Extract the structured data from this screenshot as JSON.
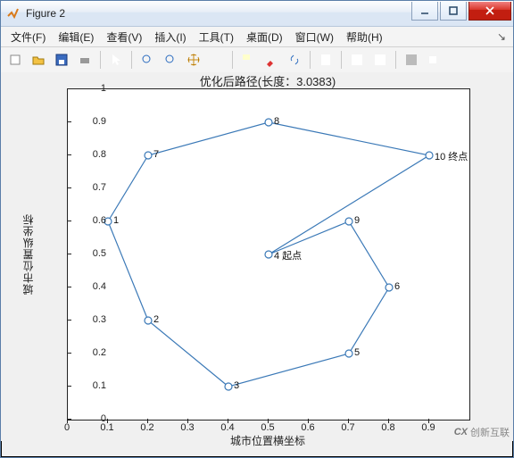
{
  "window": {
    "title": "Figure 2"
  },
  "winbtns": {
    "min": "min",
    "max": "max",
    "close": "close"
  },
  "menu": {
    "file": "文件(F)",
    "edit": "编辑(E)",
    "view": "查看(V)",
    "insert": "插入(I)",
    "tools": "工具(T)",
    "desktop": "桌面(D)",
    "window": "窗口(W)",
    "help": "帮助(H)"
  },
  "toolbar_icons": [
    "new-figure-icon",
    "open-icon",
    "save-icon",
    "print-icon",
    "sep",
    "pointer-icon",
    "sep",
    "zoom-in-icon",
    "zoom-out-icon",
    "pan-icon",
    "rotate3d-icon",
    "sep",
    "datacursor-icon",
    "brush-icon",
    "link-icon",
    "sep",
    "colorbar-icon",
    "sep",
    "legend-icon",
    "layout-icon",
    "sep",
    "dock-icon",
    "undock-icon"
  ],
  "chart_data": {
    "type": "line",
    "title": "优化后路径(长度：3.0383)",
    "xlabel": "城市位置横坐标",
    "ylabel": "城市位置纵坐标",
    "xlim": [
      0,
      1
    ],
    "ylim": [
      0,
      1
    ],
    "xticks": [
      0,
      0.1,
      0.2,
      0.3,
      0.4,
      0.5,
      0.6,
      0.7,
      0.8,
      0.9
    ],
    "yticks": [
      0,
      0.1,
      0.2,
      0.3,
      0.4,
      0.5,
      0.6,
      0.7,
      0.8,
      0.9,
      1
    ],
    "points": [
      {
        "id": 4,
        "x": 0.5,
        "y": 0.5,
        "label": "4   起点"
      },
      {
        "id": 9,
        "x": 0.7,
        "y": 0.6,
        "label": "9"
      },
      {
        "id": 6,
        "x": 0.8,
        "y": 0.4,
        "label": "6"
      },
      {
        "id": 5,
        "x": 0.7,
        "y": 0.2,
        "label": "5"
      },
      {
        "id": 3,
        "x": 0.4,
        "y": 0.1,
        "label": "3"
      },
      {
        "id": 2,
        "x": 0.2,
        "y": 0.3,
        "label": "2"
      },
      {
        "id": 1,
        "x": 0.1,
        "y": 0.6,
        "label": "1"
      },
      {
        "id": 7,
        "x": 0.2,
        "y": 0.8,
        "label": "7"
      },
      {
        "id": 8,
        "x": 0.5,
        "y": 0.9,
        "label": "8"
      },
      {
        "id": 10,
        "x": 0.9,
        "y": 0.8,
        "label": "10 终点"
      }
    ],
    "path_order": [
      4,
      9,
      6,
      5,
      3,
      2,
      1,
      7,
      8,
      10,
      4
    ]
  },
  "watermark": "创新互联"
}
